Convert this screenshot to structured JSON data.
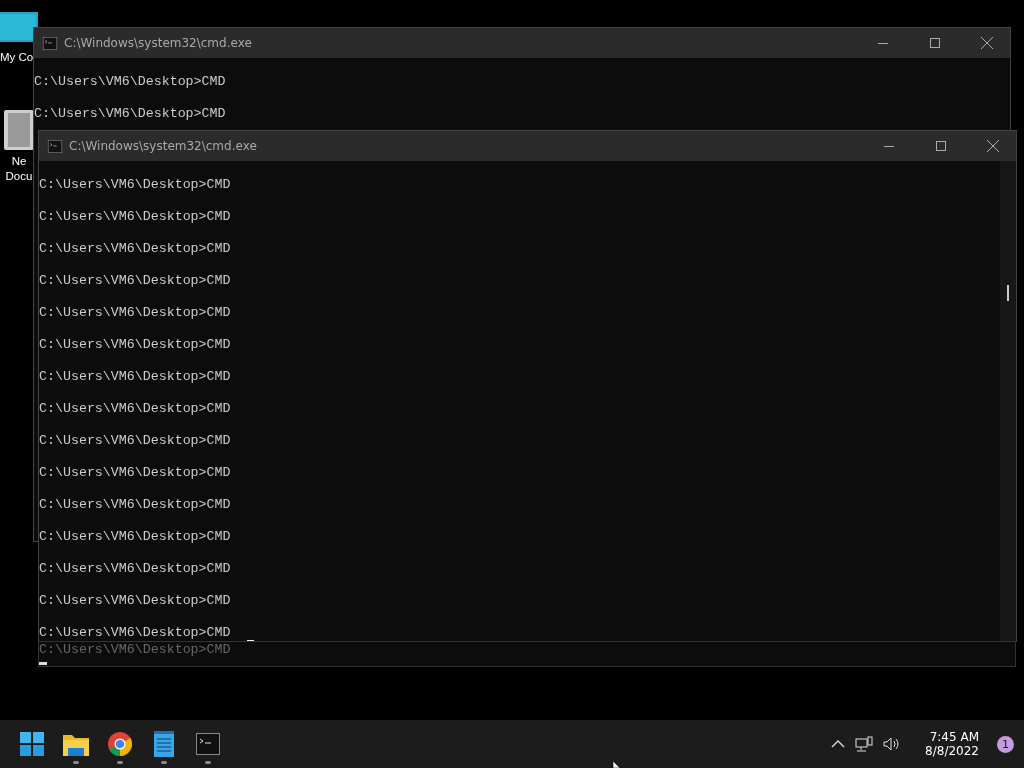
{
  "desktop_icons": [
    {
      "kind": "monitor",
      "label": [
        "My Co"
      ]
    },
    {
      "kind": "document",
      "label": [
        "Ne",
        "Docu"
      ]
    }
  ],
  "windows": [
    {
      "title": "C:\\Windows\\system32\\cmd.exe",
      "lines": [
        "C:\\Users\\VM6\\Desktop>CMD",
        "C:\\Users\\VM6\\Desktop>CMD"
      ]
    },
    {
      "title": "C:\\Windows\\system32\\cmd.exe",
      "cursor": true,
      "lines": [
        "C:\\Users\\VM6\\Desktop>CMD",
        "C:\\Users\\VM6\\Desktop>CMD",
        "C:\\Users\\VM6\\Desktop>CMD",
        "C:\\Users\\VM6\\Desktop>CMD",
        "C:\\Users\\VM6\\Desktop>CMD",
        "C:\\Users\\VM6\\Desktop>CMD",
        "C:\\Users\\VM6\\Desktop>CMD",
        "C:\\Users\\VM6\\Desktop>CMD",
        "C:\\Users\\VM6\\Desktop>CMD",
        "C:\\Users\\VM6\\Desktop>CMD",
        "C:\\Users\\VM6\\Desktop>CMD",
        "C:\\Users\\VM6\\Desktop>CMD",
        "C:\\Users\\VM6\\Desktop>CMD",
        "C:\\Users\\VM6\\Desktop>CMD",
        "C:\\Users\\VM6\\Desktop>CMD"
      ]
    }
  ],
  "ghost_strip": {
    "text": "C:\\Users\\VM6\\Desktop>CMD",
    "cursor": true
  },
  "taskbar": {
    "apps": [
      {
        "kind": "start"
      },
      {
        "kind": "explorer",
        "running": true
      },
      {
        "kind": "chrome",
        "running": true
      },
      {
        "kind": "notepad",
        "running": true
      },
      {
        "kind": "terminal",
        "running": true
      }
    ],
    "time": "7:45 AM",
    "date": "8/8/2022",
    "notification_count": "1"
  }
}
